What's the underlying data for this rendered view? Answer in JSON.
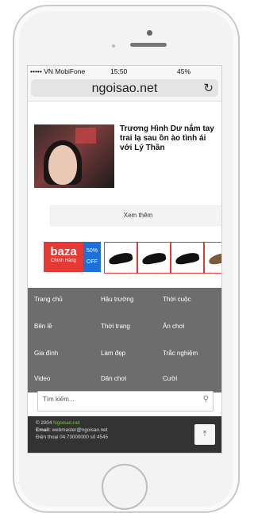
{
  "status_bar": {
    "carrier": "••••• VN MobiFone",
    "time": "15:50",
    "battery": "45%"
  },
  "browser": {
    "url": "ngoisao.net",
    "reload_icon": "reload-icon"
  },
  "article": {
    "headline": "Trương Hình Dư nắm tay trai lạ sau ồn ào tình ái với Lý Thần"
  },
  "more_button": "Xem thêm",
  "banner": {
    "brand": "baza",
    "sub": "Chính Hãng",
    "discount": "50%",
    "off": "OFF"
  },
  "nav": [
    "Trang chủ",
    "Hậu trường",
    "Thời cuộc",
    "Bên lề",
    "Thời trang",
    "Ăn chơi",
    "Gia đình",
    "Làm đẹp",
    "Trắc nghiệm",
    "Video",
    "Dân chơi",
    "Cười"
  ],
  "search": {
    "placeholder": "Tìm kiếm..."
  },
  "footer": {
    "line1_prefix": "© 2004",
    "line1_link": "Ngoisao.net",
    "line2_label": "Email:",
    "line2_value": "webmaster@ngoisao.net",
    "line3": "Điện thoại 04.73000000 số 4545"
  },
  "colors": {
    "nav_bg": "#6d6d6d",
    "footer_bg": "#333333",
    "brand_red": "#e53935",
    "off_blue": "#1e6fd8",
    "footer_link": "#7bc24a"
  }
}
